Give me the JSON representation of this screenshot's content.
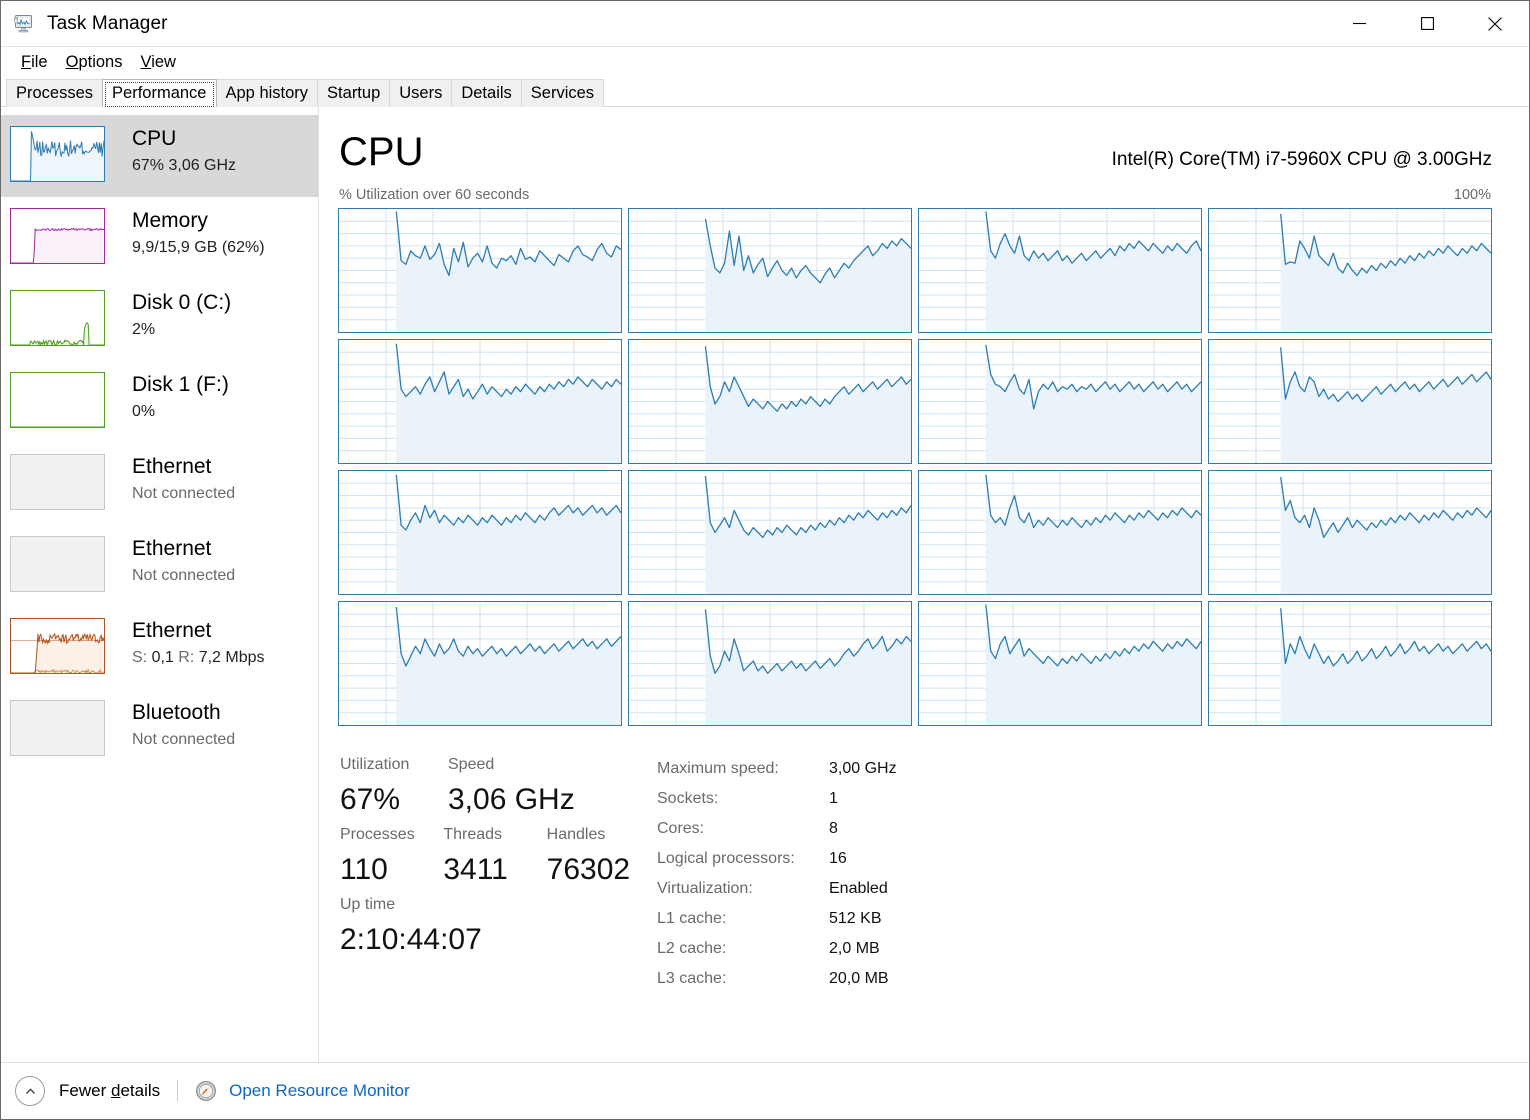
{
  "window": {
    "title": "Task Manager",
    "icon": "task-manager-icon",
    "controls": {
      "minimize": "—",
      "maximize": "□",
      "close": "✕"
    }
  },
  "menu": [
    {
      "label": "File",
      "accel": "F"
    },
    {
      "label": "Options",
      "accel": "O"
    },
    {
      "label": "View",
      "accel": "V"
    }
  ],
  "tabs": [
    {
      "label": "Processes",
      "selected": false
    },
    {
      "label": "Performance",
      "selected": true
    },
    {
      "label": "App history",
      "selected": false
    },
    {
      "label": "Startup",
      "selected": false
    },
    {
      "label": "Users",
      "selected": false
    },
    {
      "label": "Details",
      "selected": false
    },
    {
      "label": "Services",
      "selected": false
    }
  ],
  "sidebar": {
    "items": [
      {
        "name": "CPU",
        "detail": "67%  3,06 GHz",
        "selected": true,
        "graph": "cpu",
        "color": "#2e7db2",
        "fill": "#eef5fb",
        "muted": false
      },
      {
        "name": "Memory",
        "detail": "9,9/15,9 GB (62%)",
        "selected": false,
        "graph": "memory",
        "color": "#a429a4",
        "fill": "#f9f0f9",
        "muted": false
      },
      {
        "name": "Disk 0 (C:)",
        "detail": "2%",
        "selected": false,
        "graph": "disk0",
        "color": "#4f9c20",
        "fill": "#f2f9ec",
        "muted": false
      },
      {
        "name": "Disk 1 (F:)",
        "detail": "0%",
        "selected": false,
        "graph": "disk1",
        "color": "#4f9c20",
        "fill": "#ffffff",
        "muted": false
      },
      {
        "name": "Ethernet",
        "detail": "Not connected",
        "selected": false,
        "graph": "empty",
        "color": "#c8c8c8",
        "fill": "#f1f1f1",
        "muted": true
      },
      {
        "name": "Ethernet",
        "detail": "Not connected",
        "selected": false,
        "graph": "empty",
        "color": "#c8c8c8",
        "fill": "#f1f1f1",
        "muted": true
      },
      {
        "name": "Ethernet",
        "detail": "S: 0,1  R: 7,2 Mbps",
        "selected": false,
        "graph": "ethernet",
        "color": "#b4541c",
        "fill": "#fdf0e6",
        "muted": false,
        "send_label": "S:",
        "send_value": "0,1",
        "recv_label": "R:",
        "recv_value": "7,2 Mbps"
      },
      {
        "name": "Bluetooth",
        "detail": "Not connected",
        "selected": false,
        "graph": "empty",
        "color": "#c8c8c8",
        "fill": "#f1f1f1",
        "muted": true
      }
    ]
  },
  "main": {
    "title": "CPU",
    "cpu_model": "Intel(R) Core(TM) i7-5960X CPU @ 3.00GHz",
    "graph_caption": "% Utilization over 60 seconds",
    "graph_max": "100%"
  },
  "stats": {
    "utilization_label": "Utilization",
    "utilization_value": "67%",
    "speed_label": "Speed",
    "speed_value": "3,06 GHz",
    "processes_label": "Processes",
    "processes_value": "110",
    "threads_label": "Threads",
    "threads_value": "3411",
    "handles_label": "Handles",
    "handles_value": "76302",
    "uptime_label": "Up time",
    "uptime_value": "2:10:44:07"
  },
  "specs": [
    {
      "key": "Maximum speed:",
      "value": "3,00 GHz"
    },
    {
      "key": "Sockets:",
      "value": "1"
    },
    {
      "key": "Cores:",
      "value": "8"
    },
    {
      "key": "Logical processors:",
      "value": "16"
    },
    {
      "key": "Virtualization:",
      "value": "Enabled"
    },
    {
      "key": "L1 cache:",
      "value": "512 KB"
    },
    {
      "key": "L2 cache:",
      "value": "2,0 MB"
    },
    {
      "key": "L3 cache:",
      "value": "20,0 MB"
    }
  ],
  "footer": {
    "chevron_icon": "chevron-up-icon",
    "fewer_details": "Fewer details",
    "resource_monitor_icon": "resource-monitor-icon",
    "resource_monitor": "Open Resource Monitor"
  },
  "colors": {
    "cpu_line": "#2e7db2",
    "cpu_fill": "#eaf3fa",
    "grid_line": "#cfe3f1",
    "link": "#0b67c2",
    "selected_row": "#d8d8d8"
  },
  "chart_data": {
    "type": "line",
    "title": "% Utilization over 60 seconds",
    "ylabel": "% Utilization",
    "xlabel": "60 seconds",
    "ylim": [
      0,
      100
    ],
    "xlim": [
      0,
      60
    ],
    "grid": true,
    "legend": null,
    "note": "16 logical-processor utilization sub-charts, 4x4 grid. Traces begin at ~20% of the x-axis (idle/no-data before that).",
    "series": [
      {
        "name": "CPU 0",
        "values": [
          0,
          0,
          0,
          0,
          0,
          0,
          0,
          0,
          0,
          0,
          0,
          0,
          98,
          58,
          55,
          66,
          62,
          60,
          70,
          59,
          63,
          72,
          55,
          46,
          68,
          57,
          73,
          53,
          60,
          64,
          57,
          70,
          56,
          52,
          60,
          58,
          62,
          55,
          68,
          59,
          61,
          57,
          66,
          62,
          58,
          54,
          63,
          60,
          57,
          66,
          70,
          63,
          61,
          58,
          67,
          72,
          64,
          61,
          70,
          67
        ]
      },
      {
        "name": "CPU 1",
        "values": [
          0,
          0,
          0,
          0,
          0,
          0,
          0,
          0,
          0,
          0,
          0,
          0,
          0,
          0,
          0,
          0,
          92,
          70,
          52,
          48,
          56,
          82,
          54,
          78,
          50,
          62,
          48,
          55,
          60,
          45,
          52,
          58,
          50,
          46,
          52,
          44,
          50,
          54,
          48,
          44,
          40,
          47,
          52,
          44,
          50,
          56,
          52,
          58,
          62,
          66,
          70,
          62,
          66,
          72,
          68,
          74,
          70,
          76,
          72,
          68
        ]
      },
      {
        "name": "CPU 2",
        "values": [
          0,
          0,
          0,
          0,
          0,
          0,
          0,
          0,
          0,
          0,
          0,
          0,
          0,
          0,
          98,
          66,
          60,
          72,
          80,
          70,
          64,
          78,
          62,
          58,
          66,
          60,
          64,
          58,
          62,
          66,
          58,
          62,
          56,
          60,
          64,
          58,
          62,
          66,
          60,
          64,
          68,
          62,
          70,
          66,
          72,
          68,
          74,
          70,
          66,
          72,
          68,
          64,
          70,
          66,
          72,
          68,
          64,
          70,
          74,
          66
        ]
      },
      {
        "name": "CPU 3",
        "values": [
          0,
          0,
          0,
          0,
          0,
          0,
          0,
          0,
          0,
          0,
          0,
          0,
          0,
          0,
          0,
          96,
          55,
          57,
          56,
          74,
          68,
          60,
          78,
          62,
          58,
          54,
          64,
          52,
          48,
          56,
          50,
          46,
          52,
          48,
          54,
          50,
          56,
          52,
          58,
          54,
          60,
          56,
          62,
          58,
          64,
          60,
          66,
          62,
          68,
          64,
          70,
          66,
          62,
          68,
          64,
          70,
          66,
          72,
          68,
          64
        ]
      },
      {
        "name": "CPU 4",
        "values": [
          0,
          0,
          0,
          0,
          0,
          0,
          0,
          0,
          0,
          0,
          0,
          0,
          97,
          60,
          54,
          58,
          62,
          56,
          64,
          70,
          58,
          66,
          74,
          56,
          62,
          68,
          54,
          60,
          52,
          58,
          64,
          56,
          62,
          58,
          54,
          60,
          56,
          62,
          58,
          64,
          60,
          56,
          62,
          58,
          64,
          60,
          66,
          62,
          68,
          64,
          70,
          66,
          62,
          68,
          64,
          60,
          66,
          62,
          68,
          64
        ]
      },
      {
        "name": "CPU 5",
        "values": [
          0,
          0,
          0,
          0,
          0,
          0,
          0,
          0,
          0,
          0,
          0,
          0,
          0,
          0,
          0,
          0,
          95,
          62,
          48,
          54,
          66,
          58,
          70,
          62,
          54,
          46,
          52,
          48,
          44,
          50,
          46,
          42,
          48,
          44,
          50,
          46,
          52,
          48,
          54,
          50,
          46,
          52,
          48,
          54,
          58,
          62,
          56,
          60,
          64,
          58,
          62,
          66,
          60,
          64,
          68,
          62,
          66,
          70,
          64,
          68
        ]
      },
      {
        "name": "CPU 6",
        "values": [
          0,
          0,
          0,
          0,
          0,
          0,
          0,
          0,
          0,
          0,
          0,
          0,
          0,
          0,
          96,
          72,
          64,
          62,
          58,
          66,
          72,
          60,
          56,
          68,
          44,
          58,
          64,
          60,
          66,
          58,
          62,
          60,
          64,
          58,
          62,
          60,
          64,
          58,
          62,
          66,
          60,
          64,
          58,
          62,
          66,
          60,
          64,
          58,
          62,
          66,
          60,
          64,
          58,
          62,
          66,
          60,
          64,
          58,
          62,
          66
        ]
      },
      {
        "name": "CPU 7",
        "values": [
          0,
          0,
          0,
          0,
          0,
          0,
          0,
          0,
          0,
          0,
          0,
          0,
          0,
          0,
          0,
          94,
          52,
          66,
          74,
          62,
          58,
          70,
          66,
          54,
          60,
          52,
          56,
          50,
          54,
          58,
          52,
          56,
          50,
          54,
          58,
          62,
          56,
          60,
          64,
          58,
          62,
          66,
          60,
          64,
          58,
          62,
          66,
          60,
          64,
          68,
          62,
          66,
          70,
          64,
          68,
          72,
          66,
          70,
          74,
          68
        ]
      },
      {
        "name": "CPU 8",
        "values": [
          0,
          0,
          0,
          0,
          0,
          0,
          0,
          0,
          0,
          0,
          0,
          0,
          97,
          56,
          52,
          60,
          66,
          58,
          72,
          62,
          68,
          58,
          64,
          60,
          56,
          62,
          58,
          64,
          60,
          56,
          62,
          58,
          64,
          60,
          56,
          62,
          58,
          64,
          60,
          66,
          62,
          58,
          64,
          60,
          66,
          70,
          64,
          68,
          72,
          66,
          70,
          64,
          68,
          72,
          66,
          70,
          64,
          68,
          72,
          66
        ]
      },
      {
        "name": "CPU 9",
        "values": [
          0,
          0,
          0,
          0,
          0,
          0,
          0,
          0,
          0,
          0,
          0,
          0,
          0,
          0,
          0,
          0,
          96,
          58,
          50,
          56,
          62,
          54,
          68,
          60,
          52,
          48,
          54,
          50,
          46,
          52,
          48,
          54,
          50,
          56,
          52,
          48,
          54,
          50,
          56,
          52,
          58,
          54,
          60,
          56,
          62,
          58,
          64,
          60,
          66,
          62,
          68,
          64,
          60,
          66,
          62,
          68,
          64,
          70,
          66,
          72
        ]
      },
      {
        "name": "CPU 10",
        "values": [
          0,
          0,
          0,
          0,
          0,
          0,
          0,
          0,
          0,
          0,
          0,
          0,
          0,
          0,
          97,
          64,
          58,
          62,
          56,
          70,
          80,
          62,
          58,
          66,
          54,
          60,
          56,
          62,
          58,
          54,
          60,
          56,
          62,
          58,
          54,
          60,
          56,
          62,
          58,
          64,
          60,
          66,
          62,
          58,
          64,
          60,
          66,
          62,
          68,
          64,
          60,
          66,
          62,
          68,
          64,
          70,
          66,
          62,
          68,
          64
        ]
      },
      {
        "name": "CPU 11",
        "values": [
          0,
          0,
          0,
          0,
          0,
          0,
          0,
          0,
          0,
          0,
          0,
          0,
          0,
          0,
          0,
          95,
          68,
          76,
          62,
          58,
          64,
          54,
          70,
          60,
          46,
          52,
          58,
          50,
          56,
          62,
          54,
          60,
          56,
          52,
          58,
          54,
          60,
          56,
          62,
          58,
          64,
          60,
          66,
          62,
          58,
          64,
          60,
          66,
          62,
          68,
          64,
          60,
          66,
          62,
          68,
          64,
          70,
          66,
          62,
          68
        ]
      },
      {
        "name": "CPU 12",
        "values": [
          0,
          0,
          0,
          0,
          0,
          0,
          0,
          0,
          0,
          0,
          0,
          0,
          96,
          58,
          48,
          56,
          64,
          58,
          70,
          62,
          56,
          66,
          58,
          62,
          70,
          60,
          56,
          64,
          58,
          62,
          56,
          60,
          64,
          58,
          62,
          56,
          60,
          64,
          58,
          62,
          66,
          60,
          64,
          58,
          62,
          66,
          60,
          64,
          68,
          62,
          66,
          70,
          64,
          68,
          62,
          66,
          70,
          64,
          68,
          72
        ]
      },
      {
        "name": "CPU 13",
        "values": [
          0,
          0,
          0,
          0,
          0,
          0,
          0,
          0,
          0,
          0,
          0,
          0,
          0,
          0,
          0,
          0,
          94,
          56,
          42,
          48,
          60,
          52,
          70,
          58,
          44,
          48,
          52,
          44,
          48,
          42,
          46,
          50,
          44,
          48,
          52,
          46,
          50,
          44,
          48,
          52,
          46,
          50,
          54,
          48,
          52,
          58,
          62,
          56,
          60,
          66,
          70,
          62,
          66,
          72,
          60,
          64,
          70,
          66,
          72,
          68
        ]
      },
      {
        "name": "CPU 14",
        "values": [
          0,
          0,
          0,
          0,
          0,
          0,
          0,
          0,
          0,
          0,
          0,
          0,
          0,
          0,
          98,
          60,
          54,
          66,
          72,
          58,
          64,
          70,
          56,
          62,
          58,
          54,
          50,
          56,
          52,
          48,
          54,
          50,
          56,
          52,
          58,
          54,
          50,
          56,
          52,
          58,
          54,
          60,
          56,
          62,
          58,
          64,
          60,
          66,
          62,
          68,
          64,
          60,
          66,
          62,
          68,
          64,
          70,
          66,
          62,
          68
        ]
      },
      {
        "name": "CPU 15",
        "values": [
          0,
          0,
          0,
          0,
          0,
          0,
          0,
          0,
          0,
          0,
          0,
          0,
          0,
          0,
          0,
          95,
          50,
          66,
          58,
          72,
          62,
          54,
          66,
          58,
          50,
          56,
          48,
          52,
          58,
          50,
          54,
          60,
          52,
          56,
          62,
          54,
          58,
          64,
          56,
          60,
          66,
          58,
          62,
          68,
          60,
          64,
          58,
          62,
          66,
          60,
          64,
          58,
          62,
          66,
          60,
          64,
          68,
          62,
          66,
          60
        ]
      }
    ]
  }
}
